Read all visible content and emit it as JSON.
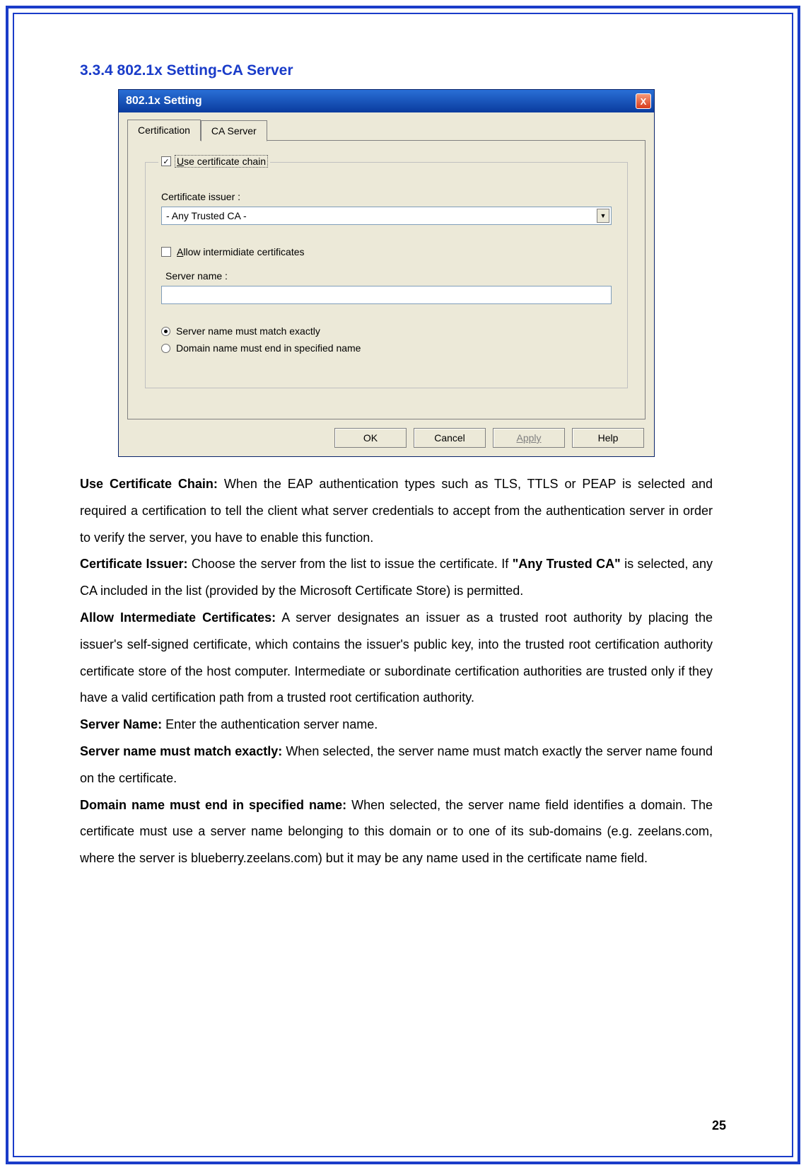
{
  "heading": "3.3.4 802.1x Setting-CA Server",
  "dialog": {
    "title": "802.1x Setting",
    "close": "X",
    "tabs": {
      "certification": "Certification",
      "caServer": "CA Server"
    },
    "useCertChain": "Use certificate chain",
    "certIssuerLabel": "Certificate issuer :",
    "certIssuerValue": "- Any Trusted CA -",
    "allowIntermediate": "Allow intermidiate certificates",
    "serverNameLabel": "Server name :",
    "serverNameValue": "",
    "radioExact": "Server name must match exactly",
    "radioDomain": "Domain name must end in specified name",
    "buttons": {
      "ok": "OK",
      "cancel": "Cancel",
      "apply": "Apply",
      "help": "Help"
    }
  },
  "descriptions": {
    "useCertChain_label": "Use Certificate Chain:",
    "useCertChain_text": " When the EAP authentication types such as TLS, TTLS or PEAP is selected and required a certification to tell the client what server credentials to accept from the authentication server in order to verify the server, you have to enable this function.",
    "certIssuer_label": "Certificate Issuer:",
    "certIssuer_text_a": " Choose the server from the list to issue the certificate. If ",
    "certIssuer_bold": "\"Any Trusted CA\"",
    "certIssuer_text_b": " is selected, any CA included in the list (provided by the Microsoft Certificate Store) is permitted.",
    "allowInt_label": "Allow Intermediate Certificates:",
    "allowInt_text": " A server designates an issuer as a trusted root authority by placing the issuer's self-signed certificate, which contains the issuer's public key, into the trusted root certification authority certificate store of the host computer. Intermediate or subordinate certification authorities are trusted only if they have a valid certification path from a trusted root certification authority.",
    "serverName_label": "Server Name:",
    "serverName_text": " Enter the authentication server name.",
    "matchExact_label": "Server name must match exactly:",
    "matchExact_text": " When selected, the server name must match exactly the server name found on the certificate.",
    "domainEnd_label": "Domain name must end in specified name:",
    "domainEnd_text": " When selected, the server name field identifies a domain. The certificate must use a server name belonging to this domain or to one of its sub-domains (e.g. zeelans.com, where the server is blueberry.zeelans.com) but it may be any name used in the certificate name field."
  },
  "pageNumber": "25"
}
